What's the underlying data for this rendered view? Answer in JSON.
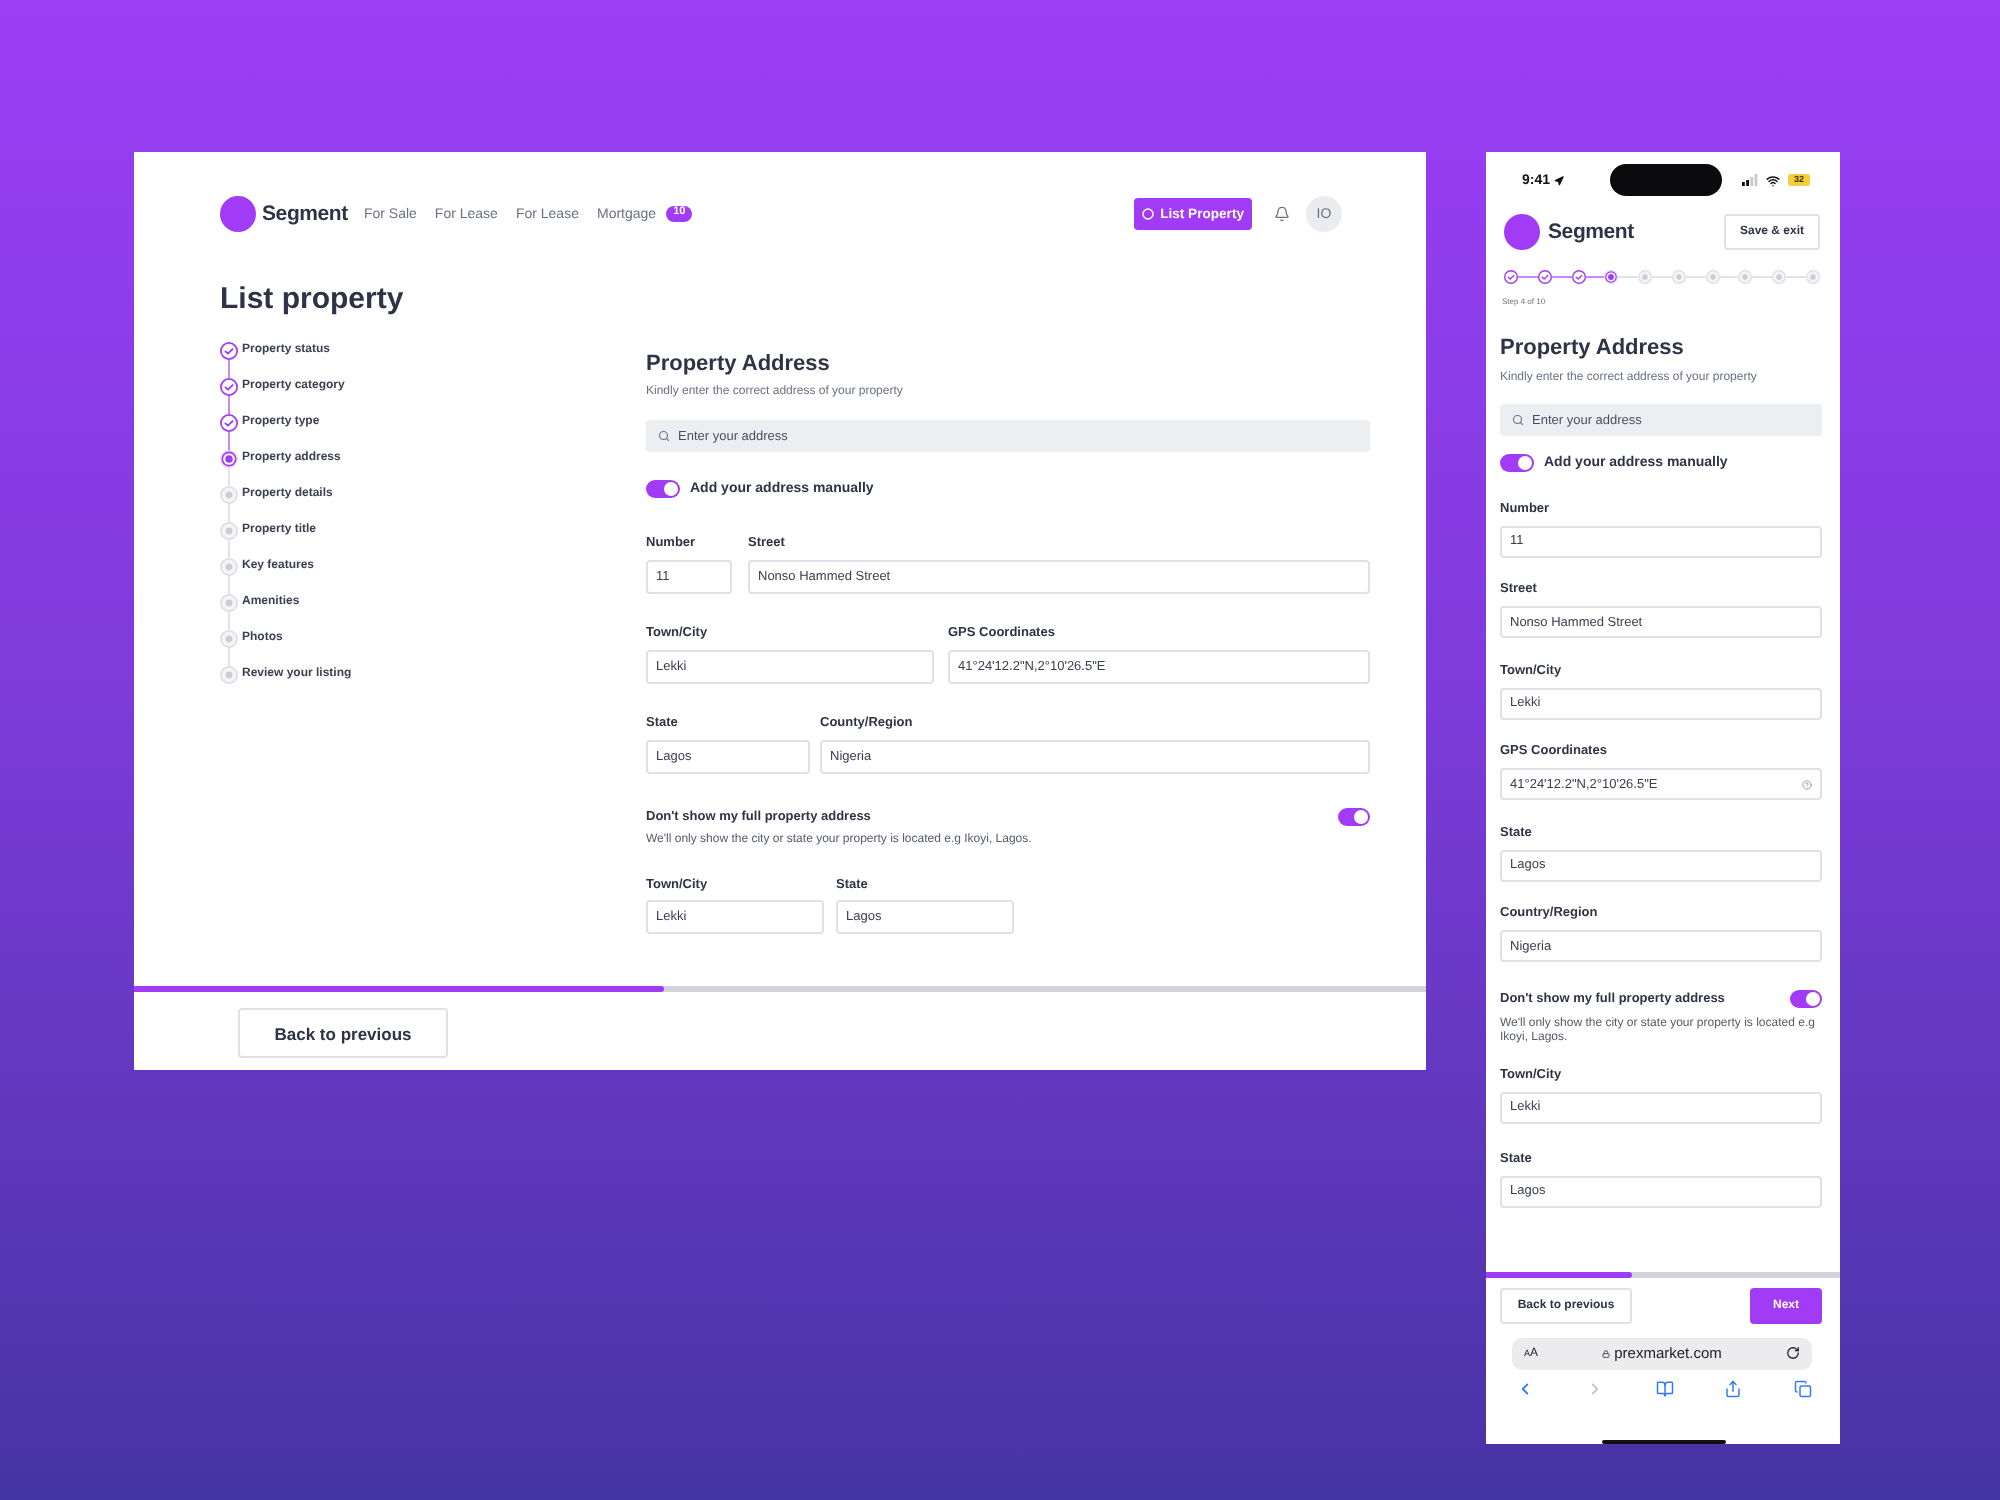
{
  "desktop": {
    "nav": {
      "brand": "Segment",
      "links": [
        {
          "label": "For Sale"
        },
        {
          "label": "For Lease"
        },
        {
          "label": "For Lease"
        },
        {
          "label": "Mortgage",
          "badge": "10"
        }
      ],
      "cta": "List Property",
      "avatar": "IO"
    },
    "page_title": "List property",
    "steps": [
      {
        "label": "Property status",
        "completed": true,
        "selected": false
      },
      {
        "label": "Property category",
        "completed": true,
        "selected": false
      },
      {
        "label": "Property type",
        "completed": true,
        "selected": false
      },
      {
        "label": "Property address",
        "completed": false,
        "selected": true
      },
      {
        "label": "Property details",
        "completed": false,
        "selected": false
      },
      {
        "label": "Property title",
        "completed": false,
        "selected": false
      },
      {
        "label": "Key features",
        "completed": false,
        "selected": false
      },
      {
        "label": "Amenities",
        "completed": false,
        "selected": false
      },
      {
        "label": "Photos",
        "completed": false,
        "selected": false
      },
      {
        "label": "Review your listing",
        "completed": false,
        "selected": false
      }
    ],
    "form": {
      "title": "Property Address",
      "subtitle": "Kindly enter the correct address of your property",
      "search": {
        "placeholder": "Enter your address"
      },
      "manual_toggle": {
        "label": "Add your address manually",
        "on": true
      },
      "field_rows": [
        [
          {
            "label": "Number",
            "value": "11"
          },
          {
            "label": "Street",
            "value": "Nonso Hammed Street"
          }
        ],
        [
          {
            "label": "Town/City",
            "value": "Lekki"
          },
          {
            "label": "GPS Coordinates",
            "value": "41°24'12.2\"N,2°10'26.5\"E"
          }
        ],
        [
          {
            "label": "State",
            "value": "Lagos"
          },
          {
            "label": "County/Region",
            "value": "Nigeria"
          }
        ]
      ],
      "privacy": {
        "label": "Don't show my full property address",
        "on": true,
        "note": "We'll only show the city or state your property is located e.g Ikoyi, Lagos.",
        "fields": [
          {
            "label": "Town/City",
            "value": "Lekki"
          },
          {
            "label": "State",
            "value": "Lagos"
          }
        ]
      }
    },
    "progress": {
      "level": 0.41
    },
    "back_button": "Back to previous"
  },
  "mobile": {
    "status_bar": {
      "time": "9:41",
      "battery": "32"
    },
    "brand": "Segment",
    "save_button": "Save & exit",
    "stepper": {
      "steps": [
        {
          "completed": true,
          "selected": false
        },
        {
          "completed": true,
          "selected": false
        },
        {
          "completed": true,
          "selected": false
        },
        {
          "completed": false,
          "selected": true
        },
        {
          "completed": false,
          "selected": false
        },
        {
          "completed": false,
          "selected": false
        },
        {
          "completed": false,
          "selected": false
        },
        {
          "completed": false,
          "selected": false
        },
        {
          "completed": false,
          "selected": false
        },
        {
          "completed": false,
          "selected": false
        }
      ],
      "caption": "Step 4 of 10"
    },
    "form": {
      "title": "Property Address",
      "subtitle": "Kindly enter the correct address of your property",
      "search": {
        "placeholder": "Enter your address"
      },
      "manual_toggle": {
        "label": "Add your address manually",
        "on": true
      },
      "fields": [
        {
          "kind": "text",
          "label": "Number",
          "value": "11"
        },
        {
          "kind": "text",
          "label": "Street",
          "value": "Nonso Hammed Street"
        },
        {
          "kind": "text",
          "label": "Town/City",
          "value": "Lekki"
        },
        {
          "kind": "coordinates",
          "label": "GPS Coordinates",
          "value": "41°24'12.2\"N,2°10'26.5\"E"
        },
        {
          "kind": "text",
          "label": "State",
          "value": "Lagos"
        },
        {
          "kind": "text",
          "label": "Country/Region",
          "value": "Nigeria"
        }
      ],
      "privacy": {
        "label": "Don't show my full property address",
        "on": true,
        "note": "We'll only show the city or state your property is located e.g Ikoyi, Lagos.",
        "fields": [
          {
            "label": "Town/City",
            "value": "Lekki"
          },
          {
            "label": "State",
            "value": "Lagos"
          }
        ]
      }
    },
    "progress": {
      "level": 0.41
    },
    "back_button": "Back to previous",
    "next_button": "Next",
    "browser": {
      "text_size": "AA",
      "url": "prexmarket.com",
      "forward_disabled": true
    }
  }
}
